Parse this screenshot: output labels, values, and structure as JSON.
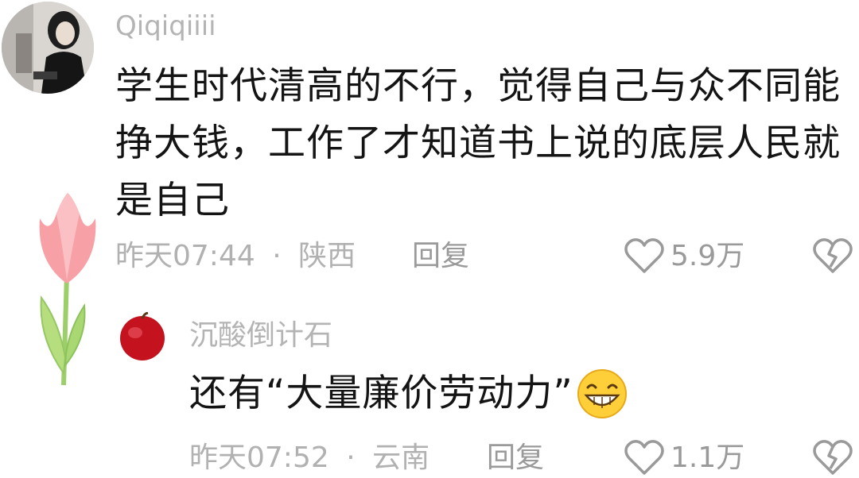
{
  "comment": {
    "username": "Qiqiqiiii",
    "text": "学生时代清高的不行，觉得自己与众不同能挣大钱，工作了才知道书上说的底层人民就是自己",
    "time": "昨天07:44",
    "separator": "·",
    "location": "陕西",
    "reply_label": "回复",
    "likes": "5.9万"
  },
  "reply": {
    "username": "沉酸倒计石",
    "text": "还有“大量廉价劳动力”",
    "time": "昨天07:52",
    "separator": "·",
    "location": "云南",
    "reply_label": "回复",
    "likes": "1.1万"
  },
  "icons": {
    "like": "heart-outline-icon",
    "dislike": "broken-heart-icon",
    "emoji": "grinning-emoji",
    "decoration": "tulip-sticker"
  },
  "colors": {
    "text": "#141414",
    "meta": "#b1b1b1",
    "icon": "#9a9a9a"
  }
}
